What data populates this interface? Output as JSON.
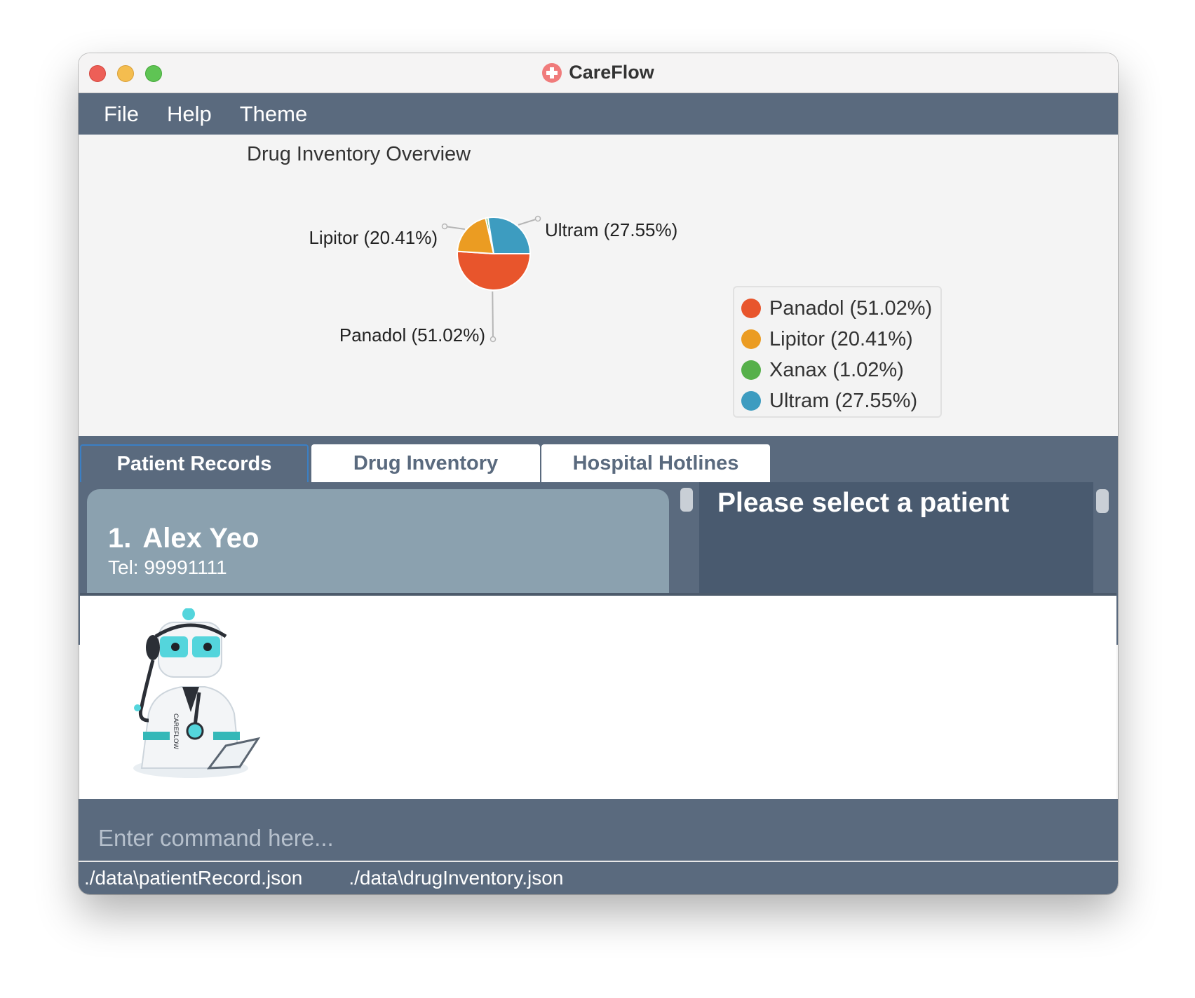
{
  "window": {
    "title": "CareFlow"
  },
  "menu": [
    {
      "label": "File"
    },
    {
      "label": "Help"
    },
    {
      "label": "Theme"
    }
  ],
  "chart_data": {
    "type": "pie",
    "title": "Drug Inventory Overview",
    "slices": [
      {
        "label": "Panadol (51.02%)",
        "name": "Panadol",
        "value": 51.02,
        "color": "#e8552c"
      },
      {
        "label": "Lipitor (20.41%)",
        "name": "Lipitor",
        "value": 20.41,
        "color": "#eb9c22"
      },
      {
        "label": "Xanax (1.02%)",
        "name": "Xanax",
        "value": 1.02,
        "color": "#56b04a"
      },
      {
        "label": "Ultram (27.55%)",
        "name": "Ultram",
        "value": 27.55,
        "color": "#3d9cc0"
      }
    ],
    "legend_position": "right"
  },
  "tabs": [
    {
      "label": "Patient Records",
      "active": true
    },
    {
      "label": "Drug Inventory",
      "active": false
    },
    {
      "label": "Hospital Hotlines",
      "active": false
    }
  ],
  "patients": [
    {
      "index": "1.",
      "name": "Alex Yeo",
      "tel": "Tel: 99991111"
    }
  ],
  "detail": {
    "placeholder": "Please select a patient"
  },
  "command": {
    "placeholder": "Enter command here..."
  },
  "status": {
    "patient_file": "./data\\patientRecord.json",
    "drug_file": "./data\\drugInventory.json"
  },
  "mascot": {
    "text": "CAREFLOW"
  }
}
